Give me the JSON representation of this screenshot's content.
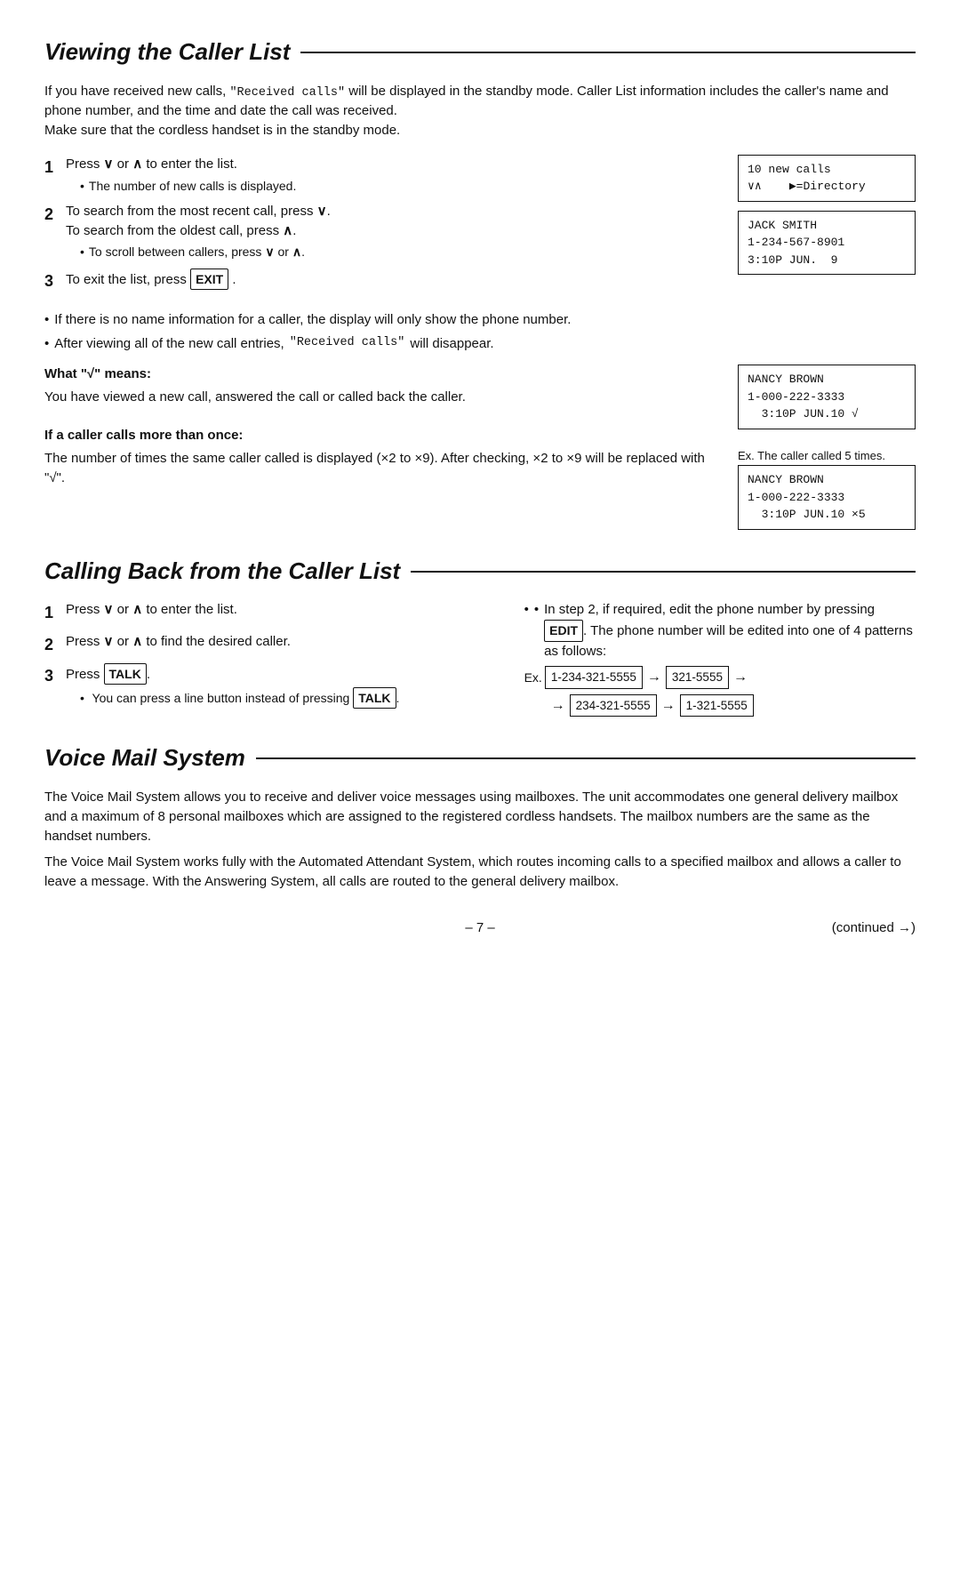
{
  "sections": {
    "viewing": {
      "title": "Viewing the Caller List",
      "intro": "If you have received new calls, “Received calls” will be displayed in the standby mode. Caller List information includes the caller’s name and phone number, and the time and date the call was received.\nMake sure that the cordless handset is in the standby mode.",
      "steps": [
        {
          "num": "1",
          "text_before": "Press",
          "arr1": "∨",
          "or": "or",
          "arr2": "∧",
          "text_after": "to enter the list.",
          "sub": "The number of new calls is displayed."
        },
        {
          "num": "2",
          "text_before": "To search from the most recent call, press",
          "arr1": "∨",
          "period": ".",
          "text_line2": "To search from the oldest call, press",
          "arr2": "∧",
          "period2": ".",
          "sub": "To scroll between callers, press ∨ or ∧."
        },
        {
          "num": "3",
          "text": "To exit the list, press",
          "key": "EXIT",
          "period": "."
        }
      ],
      "lcd1": "10 new calls\n∨∧    ▶=Directory",
      "lcd2": "JACK SMITH\n1-234-567-8901\n3:10P JUN.  9",
      "bullets": [
        "If there is no name information for a caller, the display will only show the phone number.",
        "After viewing all of the new call entries, “Received calls” will disappear."
      ],
      "what_sqrt_label": "What “√” means:",
      "what_sqrt_text": "You have viewed a new call, answered the call or called back the caller.",
      "if_caller_label": "If a caller calls more than once:",
      "if_caller_text": "The number of times the same caller called is displayed (×2 to ×9). After checking, ×2 to ×9 will be replaced with “√”.",
      "lcd3": "NANCY BROWN\n1-000-222-3333\n  3:10P JUN.10 √",
      "lcd4_label": "Ex. The caller called 5 times.",
      "lcd4": "NANCY BROWN\n1-000-222-3333\n  3:10P JUN.10 ×5"
    },
    "callback": {
      "title": "Calling Back from the Caller List",
      "steps_left": [
        {
          "num": "1",
          "text": "Press ∨ or ∧ to enter the list."
        },
        {
          "num": "2",
          "text": "Press ∨ or ∧ to find the desired caller."
        },
        {
          "num": "3",
          "text": "Press",
          "key": "TALK",
          "period": ".",
          "sub": "You can press a line button instead of pressing",
          "sub_key": "TALK",
          "sub_period": "."
        }
      ],
      "right_text": "In step 2, if required, edit the phone number by pressing",
      "right_key": "EDIT",
      "right_text2": ". The phone number will be edited into one of 4 patterns as follows:",
      "ex_label": "Ex.",
      "pattern": {
        "box1": "1-234-321-5555",
        "arr1": "→",
        "box2": "321-5555",
        "arr2": "→",
        "arr3": "→",
        "box3": "234-321-5555",
        "arr4": "→",
        "box4": "1-321-5555"
      }
    },
    "voicemail": {
      "title": "Voice Mail System",
      "para1": "The Voice Mail System allows you to receive and deliver voice messages using mailboxes. The unit accommodates one general delivery mailbox and a maximum of 8 personal mailboxes which are assigned to the registered cordless handsets. The mailbox numbers are the same as the handset numbers.",
      "para2": "The Voice Mail System works fully with the Automated Attendant System, which routes incoming calls to a specified mailbox and allows a caller to leave a message. With the Answering System, all calls are routed to the general delivery mailbox."
    }
  },
  "footer": {
    "page": "– 7 –",
    "continued": "(continued →)"
  }
}
